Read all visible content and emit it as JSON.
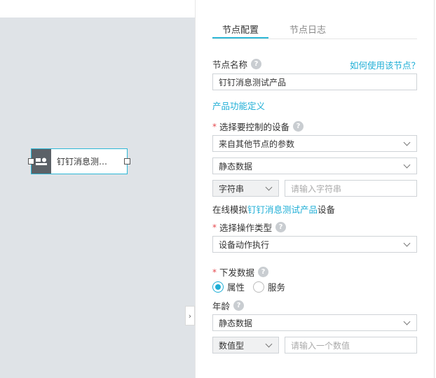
{
  "canvas": {
    "node": {
      "label": "钉钉消息测…",
      "icon": "device-node-icon"
    }
  },
  "panel": {
    "tabs": [
      {
        "label": "节点配置",
        "active": true
      },
      {
        "label": "节点日志",
        "active": false
      }
    ],
    "node_name": {
      "label": "节点名称",
      "help_link": "如何使用该节点？",
      "value": "钉钉消息测试产品"
    },
    "section_title": "产品功能定义",
    "device": {
      "label": "选择要控制的设备",
      "source_select": "来自其他节点的参数",
      "data_select": "静态数据",
      "type_select": "字符串",
      "value_placeholder": "请输入字符串"
    },
    "simulate": {
      "prefix": "在线模拟",
      "product": "钉钉消息测试产品",
      "suffix": "设备"
    },
    "operation": {
      "label": "选择操作类型",
      "select": "设备动作执行"
    },
    "downlink": {
      "label": "下发数据",
      "options": [
        {
          "label": "属性",
          "checked": true
        },
        {
          "label": "服务",
          "checked": false
        }
      ]
    },
    "age": {
      "label": "年龄",
      "data_select": "静态数据",
      "type_select": "数值型",
      "value_placeholder": "请输入一个数值"
    }
  },
  "colors": {
    "accent": "#1eaed6",
    "required": "#e5484d"
  }
}
